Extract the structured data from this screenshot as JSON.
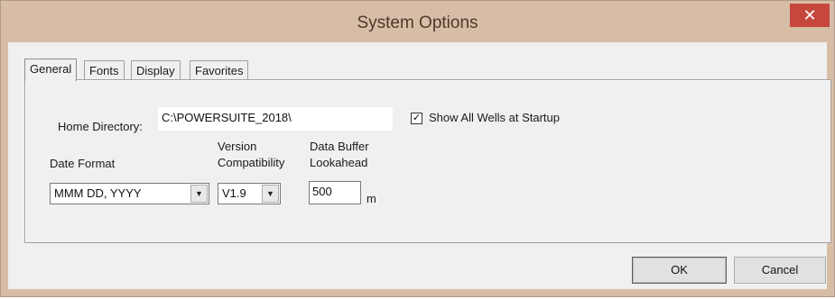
{
  "window": {
    "title": "System Options",
    "close_glyph": "✕"
  },
  "tabs": [
    {
      "label": "General",
      "active": true
    },
    {
      "label": "Fonts",
      "active": false
    },
    {
      "label": "Display",
      "active": false
    },
    {
      "label": "Favorites",
      "active": false
    }
  ],
  "general": {
    "home_directory_label": "Home Directory:",
    "home_directory_value": "C:\\POWERSUITE_2018\\",
    "show_all_wells_label": "Show All Wells at Startup",
    "show_all_wells_checked": true,
    "check_glyph": "✓",
    "date_format_label": "Date Format",
    "date_format_value": "MMM DD, YYYY",
    "version_label_line1": "Version",
    "version_label_line2": "Compatibility",
    "version_value": "V1.9",
    "buffer_label_line1": "Data Buffer",
    "buffer_label_line2": "Lookahead",
    "buffer_value": "500",
    "buffer_unit": "m",
    "dropdown_glyph": "▼"
  },
  "buttons": {
    "ok_label": "OK",
    "cancel_label": "Cancel"
  }
}
